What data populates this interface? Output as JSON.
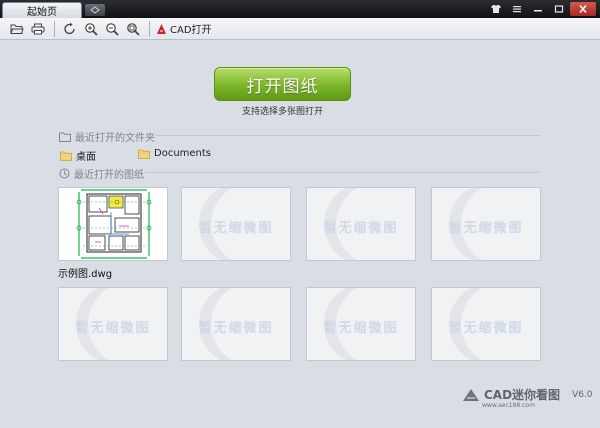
{
  "window": {
    "tab_title": "起始页",
    "tab_add_icon": "add-tab-icon"
  },
  "toolbar": {
    "cad_label": "CAD打开"
  },
  "open": {
    "button_label": "打开图纸",
    "hint": "支持选择多张图打开"
  },
  "recent_folders": {
    "title": "最近打开的文件夹",
    "items": [
      {
        "label": "桌面"
      },
      {
        "label": "Documents"
      }
    ]
  },
  "recent_drawings": {
    "title": "最近打开的图纸",
    "placeholder_text": "暂无缩微图",
    "items": [
      {
        "label": "示例图.dwg"
      }
    ]
  },
  "footer": {
    "brand": "CAD迷你看图",
    "version": "V6.0",
    "url": "www.aec188.com"
  },
  "colors": {
    "accent_green": "#7cb527",
    "background": "#d9dde4",
    "titlebar": "#1a1b1e"
  }
}
